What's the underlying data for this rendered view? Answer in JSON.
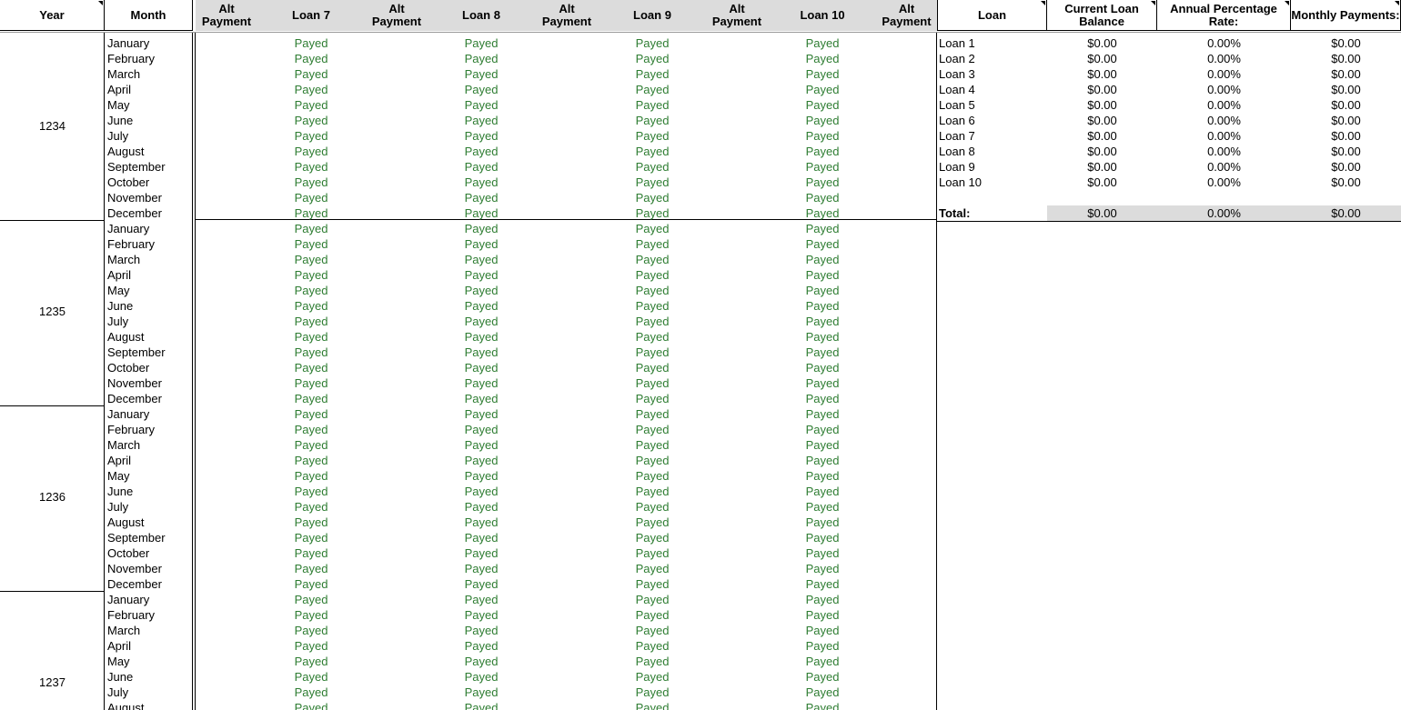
{
  "header": {
    "year": "Year",
    "month": "Month",
    "alt_payment": "Alt Payment",
    "loan7": "Loan 7",
    "loan8": "Loan 8",
    "loan9": "Loan 9",
    "loan10": "Loan 10",
    "loan": "Loan",
    "current_balance": "Current Loan Balance",
    "apr": "Annual Percentage Rate:",
    "monthly_payments": "Monthly Payments:"
  },
  "status_value": "Payed",
  "colors": {
    "payed": "#2e7d32",
    "header_bg": "#dcdcdc"
  },
  "months": [
    "January",
    "February",
    "March",
    "April",
    "May",
    "June",
    "July",
    "August",
    "September",
    "October",
    "November",
    "December"
  ],
  "years": [
    "1234",
    "1235",
    "1236",
    "1237"
  ],
  "summary": {
    "rows": [
      {
        "loan": "Loan 1",
        "balance": "$0.00",
        "apr": "0.00%",
        "payment": "$0.00"
      },
      {
        "loan": "Loan 2",
        "balance": "$0.00",
        "apr": "0.00%",
        "payment": "$0.00"
      },
      {
        "loan": "Loan 3",
        "balance": "$0.00",
        "apr": "0.00%",
        "payment": "$0.00"
      },
      {
        "loan": "Loan 4",
        "balance": "$0.00",
        "apr": "0.00%",
        "payment": "$0.00"
      },
      {
        "loan": "Loan 5",
        "balance": "$0.00",
        "apr": "0.00%",
        "payment": "$0.00"
      },
      {
        "loan": "Loan 6",
        "balance": "$0.00",
        "apr": "0.00%",
        "payment": "$0.00"
      },
      {
        "loan": "Loan 7",
        "balance": "$0.00",
        "apr": "0.00%",
        "payment": "$0.00"
      },
      {
        "loan": "Loan 8",
        "balance": "$0.00",
        "apr": "0.00%",
        "payment": "$0.00"
      },
      {
        "loan": "Loan 9",
        "balance": "$0.00",
        "apr": "0.00%",
        "payment": "$0.00"
      },
      {
        "loan": "Loan 10",
        "balance": "$0.00",
        "apr": "0.00%",
        "payment": "$0.00"
      }
    ],
    "total": {
      "label": "Total:",
      "balance": "$0.00",
      "apr": "0.00%",
      "payment": "$0.00"
    }
  }
}
